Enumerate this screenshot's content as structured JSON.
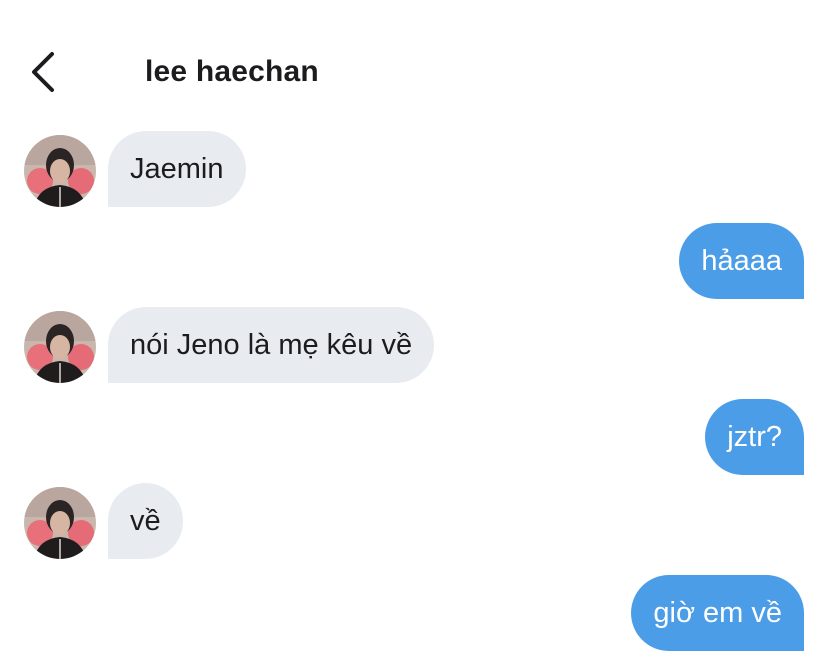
{
  "header": {
    "title": "lee haechan",
    "back_icon": "chevron-left-icon"
  },
  "colors": {
    "incoming_bubble": "#e8ecf0",
    "outgoing_bubble": "#4c9de8",
    "outgoing_text": "#ffffff"
  },
  "messages": [
    {
      "direction": "incoming",
      "text": "Jaemin"
    },
    {
      "direction": "outgoing",
      "text": "hảaaa"
    },
    {
      "direction": "incoming",
      "text": "nói Jeno là mẹ kêu về"
    },
    {
      "direction": "outgoing",
      "text": "jztr?"
    },
    {
      "direction": "incoming",
      "text": "về"
    },
    {
      "direction": "outgoing",
      "text": "giờ em về"
    }
  ]
}
